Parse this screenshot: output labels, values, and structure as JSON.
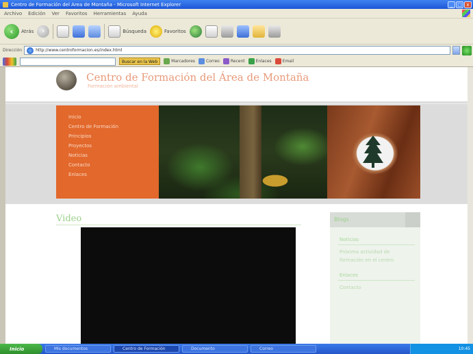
{
  "window": {
    "title": "Centro de Formación del Área de Montaña - Microsoft Internet Explorer",
    "min_label": "_",
    "max_label": "□",
    "close_label": "x"
  },
  "menu": [
    "Archivo",
    "Edición",
    "Ver",
    "Favoritos",
    "Herramientas",
    "Ayuda"
  ],
  "toolbar": {
    "back_label": "Atrás",
    "search_label": "Búsqueda",
    "favorites_label": "Favoritos"
  },
  "address": {
    "label": "Dirección",
    "url": "http://www.centroformacion.es/index.html"
  },
  "google": {
    "search_button": "Buscar en la Web",
    "items": [
      "Marcadores",
      "Correo",
      "Recent",
      "Enlaces",
      "Email"
    ]
  },
  "site": {
    "title": "Centro de Formación del Área de Montaña",
    "subtitle": "Formación ambiental"
  },
  "nav": [
    "Inicio",
    "Centro de Formación",
    "Principios",
    "Proyectos",
    "Noticias",
    "Contacto",
    "Enlaces"
  ],
  "main": {
    "title": "Video"
  },
  "sidebar": {
    "header": "Blogs",
    "section1_title": "Noticias",
    "section1_text": "Próxima actividad de formación en el centro",
    "section2_title": "Enlaces",
    "link1": "Contacto"
  },
  "taskbar": {
    "start_label": "Inicio",
    "tasks": [
      "Mis documentos",
      "Centro de Formación",
      "Documento",
      "Correo"
    ],
    "clock": "10:45"
  },
  "colors": {
    "nav_panel": "#e2682c",
    "title_accent": "#9bd08a",
    "site_title": "#e89a7a"
  }
}
